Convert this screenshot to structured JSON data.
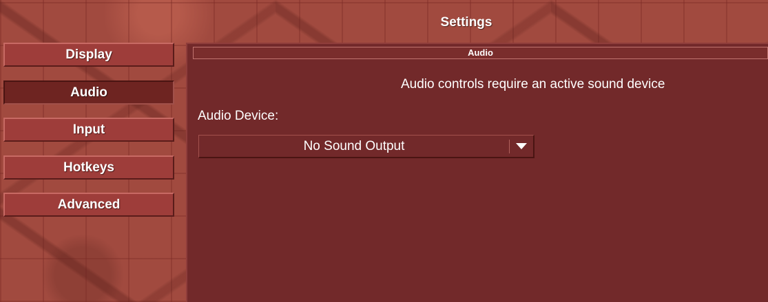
{
  "window": {
    "title": "Settings"
  },
  "sidebar": {
    "items": [
      {
        "label": "Display",
        "active": false
      },
      {
        "label": "Audio",
        "active": true
      },
      {
        "label": "Input",
        "active": false
      },
      {
        "label": "Hotkeys",
        "active": false
      },
      {
        "label": "Advanced",
        "active": false
      }
    ]
  },
  "panel": {
    "header": "Audio",
    "notice": "Audio controls require an active sound device",
    "device_label": "Audio Device:",
    "device_select": {
      "value": "No Sound Output"
    }
  },
  "colors": {
    "panel_bg": "#72292a",
    "button_bg": "#9e3d3a",
    "active_button_bg": "#6e2421",
    "text": "#ffffff"
  }
}
